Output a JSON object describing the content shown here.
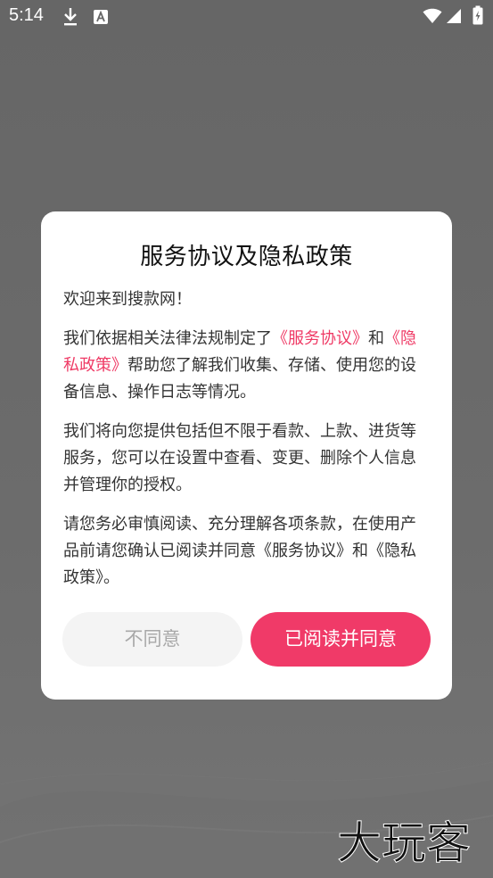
{
  "status_bar": {
    "time": "5:14",
    "icons": [
      "download-icon",
      "text-a-icon",
      "wifi-icon",
      "signal-icon",
      "battery-charging-icon"
    ]
  },
  "dialog": {
    "title": "服务协议及隐私政策",
    "greeting": "欢迎来到搜款网！",
    "para1": {
      "prefix": "我们依据相关法律法规制定了",
      "link_service": "《服务协议》",
      "and": "和",
      "link_privacy": "《隐私政策》",
      "suffix": "帮助您了解我们收集、存储、使用您的设备信息、操作日志等情况。"
    },
    "para2": "我们将向您提供包括但不限于看款、上款、进货等服务，您可以在设置中查看、变更、删除个人信息并管理你的授权。",
    "para3": "请您务必审慎阅读、充分理解各项条款，在使用产品前请您确认已阅读并同意《服务协议》和《隐私政策》。",
    "disagree_label": "不同意",
    "agree_label": "已阅读并同意"
  },
  "watermark_text": "大玩客",
  "colors": {
    "accent": "#f03a68",
    "link": "#ef3a65",
    "overlay": "#6a6a6a"
  }
}
